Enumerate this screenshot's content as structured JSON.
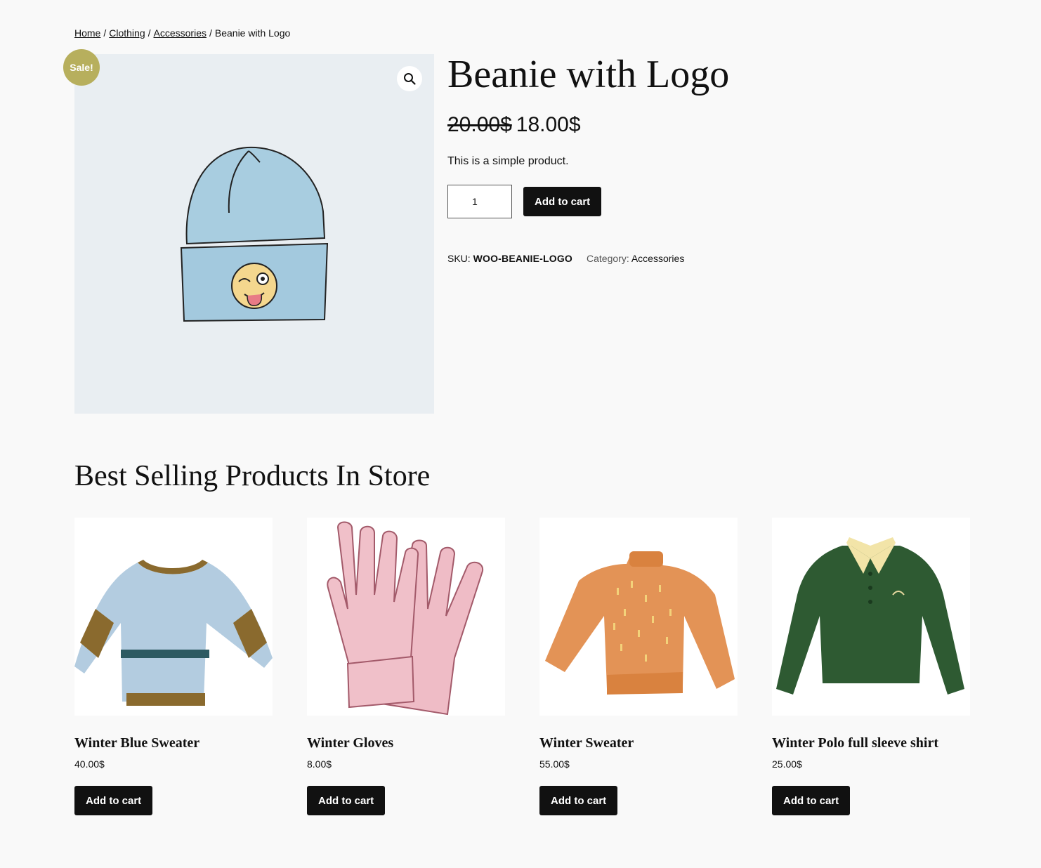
{
  "breadcrumb": {
    "home": "Home",
    "clothing": "Clothing",
    "accessories": "Accessories",
    "current": "Beanie with Logo",
    "separator": "/"
  },
  "gallery": {
    "sale_badge": "Sale!",
    "zoom_icon": "magnifier-icon"
  },
  "product": {
    "title": "Beanie with Logo",
    "regular_price": "20.00$",
    "sale_price": "18.00$",
    "short_description": "This is a simple product.",
    "quantity": "1",
    "add_to_cart_label": "Add to cart",
    "sku_label": "SKU:",
    "sku_value": "WOO-BEANIE-LOGO",
    "category_label": "Category:",
    "category_value": "Accessories"
  },
  "related": {
    "title": "Best Selling Products In Store",
    "items": [
      {
        "name": "Winter Blue Sweater",
        "price": "40.00$",
        "button": "Add to cart"
      },
      {
        "name": "Winter Gloves",
        "price": "8.00$",
        "button": "Add to cart"
      },
      {
        "name": "Winter Sweater",
        "price": "55.00$",
        "button": "Add to cart"
      },
      {
        "name": "Winter Polo full sleeve shirt",
        "price": "25.00$",
        "button": "Add to cart"
      }
    ]
  },
  "colors": {
    "accent": "#111111",
    "sale_badge": "#b7af5d",
    "gallery_bg": "#e9eef2",
    "page_bg": "#f9f9f9"
  }
}
